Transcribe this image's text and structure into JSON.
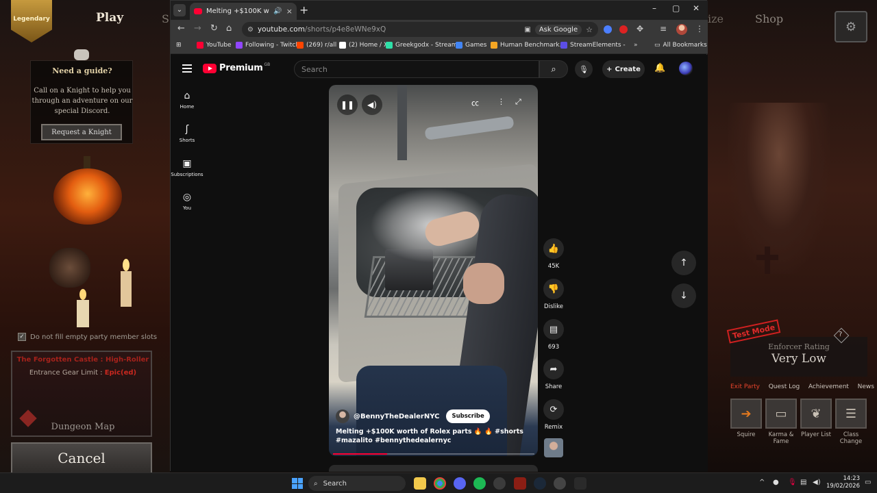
{
  "game": {
    "badge": "Legendary",
    "nav": {
      "play": "Play",
      "partial_left": "S",
      "partial_right": "ize",
      "shop": "Shop"
    },
    "guide": {
      "title": "Need a guide?",
      "text": "Call on a Knight to help you through an adventure on our special Discord.",
      "button": "Request a Knight"
    },
    "party_checkbox": {
      "checked": true,
      "label": "Do not fill empty party member slots"
    },
    "dungeon": {
      "title": "The Forgotten Castle : High-Roller",
      "gear_limit_label": "Entrance Gear Limit :",
      "gear_limit_value": "Epic(ed)",
      "map_button": "Dungeon Map"
    },
    "cancel_button": "Cancel",
    "test_mode": "Test Mode",
    "enforcer": {
      "label": "Enforcer Rating",
      "value": "Very Low"
    },
    "tabs": [
      "Exit Party",
      "Quest Log",
      "Achievement",
      "News"
    ],
    "icon_buttons": [
      {
        "label": "Squire",
        "icon": "arrow-right-icon"
      },
      {
        "label": "Karma & Fame",
        "icon": "book-icon"
      },
      {
        "label": "Player List",
        "icon": "laurel-icon"
      },
      {
        "label": "Class Change",
        "icon": "scroll-icon"
      }
    ]
  },
  "browser": {
    "tab": {
      "title": "Melting +$100K worth of R",
      "close": "×"
    },
    "window_controls": {
      "minimize": "–",
      "maximize": "▢",
      "close": "✕"
    },
    "url_main": "youtube.com",
    "url_path": "/shorts/p4e8eWNe9xQ",
    "ask_google": "Ask Google",
    "bookmarks": [
      {
        "label": "YouTube",
        "color": "#ff0033"
      },
      {
        "label": "Following - Twitch",
        "color": "#9146ff"
      },
      {
        "label": "(269) r/all",
        "color": "#ff4500"
      },
      {
        "label": "(2) Home / X",
        "color": "#ffffff"
      },
      {
        "label": "Greekgodx - Stream...",
        "color": "#2ee0a8"
      },
      {
        "label": "Games",
        "color": "#4285f4"
      },
      {
        "label": "Human Benchmark...",
        "color": "#f5a623"
      },
      {
        "label": "StreamElements -",
        "color": "#5c4ee5"
      }
    ],
    "all_bookmarks": "All Bookmarks"
  },
  "youtube": {
    "logo_text": "Premium",
    "logo_region": "GB",
    "search_placeholder": "Search",
    "create_label": "Create",
    "sidebar": [
      {
        "label": "Home",
        "icon": "home-icon"
      },
      {
        "label": "Shorts",
        "icon": "shorts-icon"
      },
      {
        "label": "Subscriptions",
        "icon": "subscriptions-icon"
      },
      {
        "label": "You",
        "icon": "you-icon"
      }
    ],
    "short": {
      "channel": "@BennyTheDealerNYC",
      "subscribe": "Subscribe",
      "caption": "Melting +$100K worth of Rolex parts 🔥 🔥 #shorts #mazalito #bennythedealernyc",
      "progress": 0.27
    },
    "actions": [
      {
        "label": "45K",
        "icon": "like-icon"
      },
      {
        "label": "Dislike",
        "icon": "dislike-icon"
      },
      {
        "label": "693",
        "icon": "comment-icon"
      },
      {
        "label": "Share",
        "icon": "share-icon"
      },
      {
        "label": "Remix",
        "icon": "remix-icon"
      }
    ]
  },
  "taskbar": {
    "search": "Search",
    "time": "14:23",
    "date": "19/02/2026"
  }
}
